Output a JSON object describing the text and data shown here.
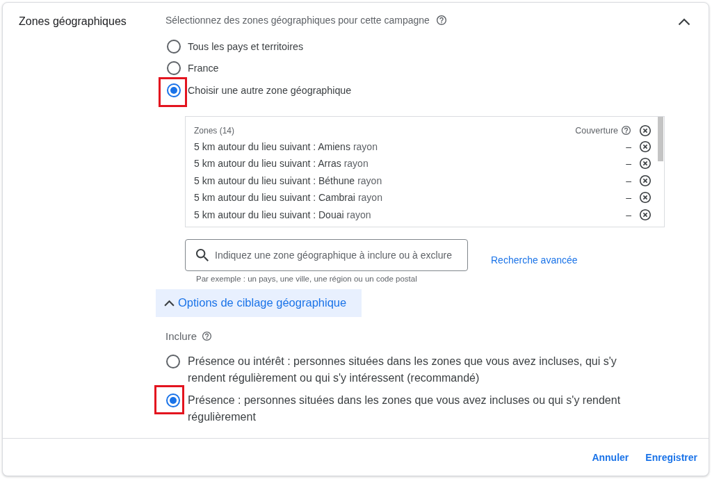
{
  "section": {
    "title": "Zones géographiques",
    "expanded": true
  },
  "location_prompt": {
    "text": "Sélectionnez des zones géographiques pour cette campagne"
  },
  "location_options": [
    {
      "label": "Tous les pays et territoires",
      "selected": false,
      "highlighted": false
    },
    {
      "label": "France",
      "selected": false,
      "highlighted": false
    },
    {
      "label": "Choisir une autre zone géographique",
      "selected": true,
      "highlighted": true
    }
  ],
  "zones": {
    "header": "Zones (14)",
    "coverage_header": "Couverture",
    "rows": [
      {
        "place": "5 km autour du lieu suivant : Amiens",
        "suffix": "rayon",
        "coverage": "–"
      },
      {
        "place": "5 km autour du lieu suivant : Arras",
        "suffix": "rayon",
        "coverage": "–"
      },
      {
        "place": "5 km autour du lieu suivant : Béthune",
        "suffix": "rayon",
        "coverage": "–"
      },
      {
        "place": "5 km autour du lieu suivant : Cambrai",
        "suffix": "rayon",
        "coverage": "–"
      },
      {
        "place": "5 km autour du lieu suivant : Douai",
        "suffix": "rayon",
        "coverage": "–"
      }
    ]
  },
  "search": {
    "placeholder": "Indiquez une zone géographique à inclure ou à exclure",
    "hint": "Par exemple : un pays, une ville, une région ou un code postal",
    "advanced_link": "Recherche avancée"
  },
  "targeting_options": {
    "label": "Options de ciblage géographique",
    "expanded": true,
    "include_label": "Inclure",
    "options": [
      {
        "label": "Présence ou intérêt : personnes situées dans les zones que vous avez incluses, qui s'y rendent régulièrement ou qui s'y intéressent (recommandé)",
        "selected": false,
        "highlighted": false
      },
      {
        "label": "Présence : personnes situées dans les zones que vous avez incluses ou qui s'y rendent régulièrement",
        "selected": true,
        "highlighted": true
      }
    ]
  },
  "footer": {
    "buttons": [
      "Annuler",
      "Enregistrer"
    ]
  }
}
